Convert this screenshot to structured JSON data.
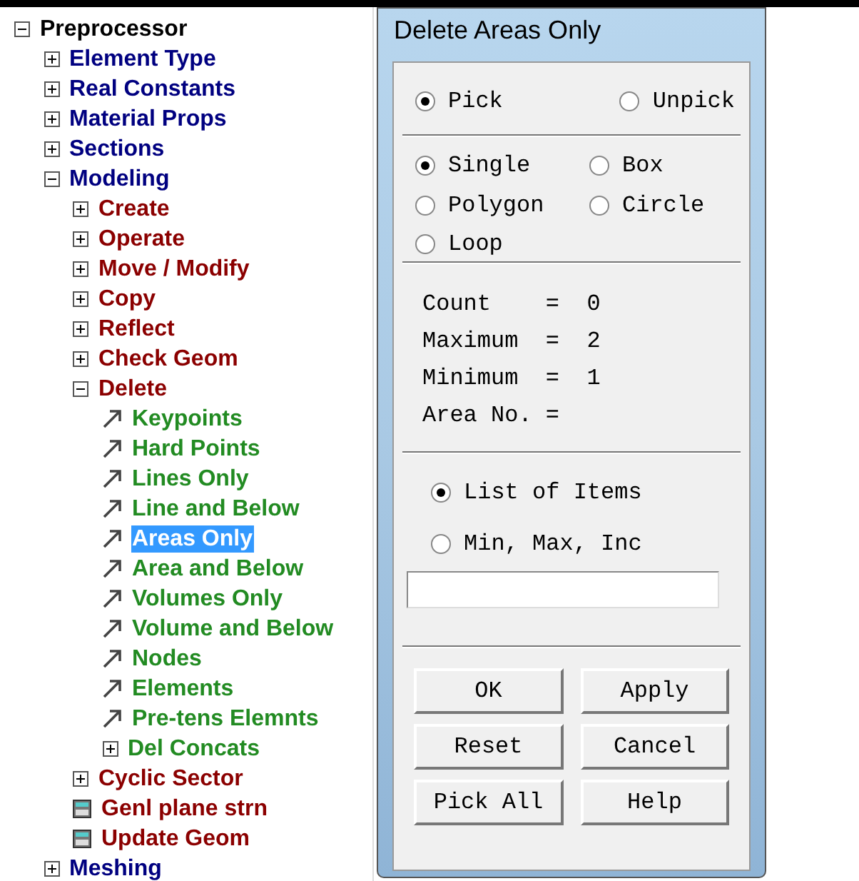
{
  "tree": [
    {
      "label": "Preprocessor",
      "kind": "folder",
      "expanded": true,
      "selected": false,
      "children": [
        {
          "label": "Element Type",
          "kind": "folder",
          "expanded": false,
          "selected": false
        },
        {
          "label": "Real Constants",
          "kind": "folder",
          "expanded": false,
          "selected": false
        },
        {
          "label": "Material Props",
          "kind": "folder",
          "expanded": false,
          "selected": false
        },
        {
          "label": "Sections",
          "kind": "folder",
          "expanded": false,
          "selected": false
        },
        {
          "label": "Modeling",
          "kind": "folder",
          "expanded": true,
          "selected": false,
          "children": [
            {
              "label": "Create",
              "kind": "folder",
              "expanded": false,
              "selected": false
            },
            {
              "label": "Operate",
              "kind": "folder",
              "expanded": false,
              "selected": false
            },
            {
              "label": "Move / Modify",
              "kind": "folder",
              "expanded": false,
              "selected": false
            },
            {
              "label": "Copy",
              "kind": "folder",
              "expanded": false,
              "selected": false
            },
            {
              "label": "Reflect",
              "kind": "folder",
              "expanded": false,
              "selected": false
            },
            {
              "label": "Check Geom",
              "kind": "folder",
              "expanded": false,
              "selected": false
            },
            {
              "label": "Delete",
              "kind": "folder",
              "expanded": true,
              "selected": false,
              "children": [
                {
                  "label": "Keypoints",
                  "kind": "action",
                  "selected": false
                },
                {
                  "label": "Hard Points",
                  "kind": "action",
                  "selected": false
                },
                {
                  "label": "Lines Only",
                  "kind": "action",
                  "selected": false
                },
                {
                  "label": "Line and Below",
                  "kind": "action",
                  "selected": false
                },
                {
                  "label": "Areas Only",
                  "kind": "action",
                  "selected": true
                },
                {
                  "label": "Area and Below",
                  "kind": "action",
                  "selected": false
                },
                {
                  "label": "Volumes Only",
                  "kind": "action",
                  "selected": false
                },
                {
                  "label": "Volume and Below",
                  "kind": "action",
                  "selected": false
                },
                {
                  "label": "Nodes",
                  "kind": "action",
                  "selected": false
                },
                {
                  "label": "Elements",
                  "kind": "action",
                  "selected": false
                },
                {
                  "label": "Pre-tens Elemnts",
                  "kind": "action",
                  "selected": false
                },
                {
                  "label": "Del Concats",
                  "kind": "folder",
                  "expanded": false,
                  "selected": false
                }
              ]
            },
            {
              "label": "Cyclic Sector",
              "kind": "folder",
              "expanded": false,
              "selected": false
            },
            {
              "label": "Genl plane strn",
              "kind": "dialog",
              "selected": false
            },
            {
              "label": "Update Geom",
              "kind": "dialog",
              "selected": false
            }
          ]
        },
        {
          "label": "Meshing",
          "kind": "folder",
          "expanded": false,
          "selected": false
        }
      ]
    }
  ],
  "dialog": {
    "title": "Delete Areas Only",
    "pick_mode": [
      {
        "label": "Pick",
        "selected": true
      },
      {
        "label": "Unpick",
        "selected": false
      }
    ],
    "pick_shape": [
      {
        "label": "Single",
        "selected": true
      },
      {
        "label": "Box",
        "selected": false
      },
      {
        "label": "Polygon",
        "selected": false
      },
      {
        "label": "Circle",
        "selected": false
      },
      {
        "label": "Loop",
        "selected": false
      }
    ],
    "counts": [
      "Count    =  0",
      "Maximum  =  2",
      "Minimum  =  1",
      "Area No. ="
    ],
    "list_mode": [
      {
        "label": "List of Items",
        "selected": true
      },
      {
        "label": "Min, Max, Inc",
        "selected": false
      }
    ],
    "buttons": [
      "OK",
      "Apply",
      "Reset",
      "Cancel",
      "Pick All",
      "Help"
    ]
  }
}
